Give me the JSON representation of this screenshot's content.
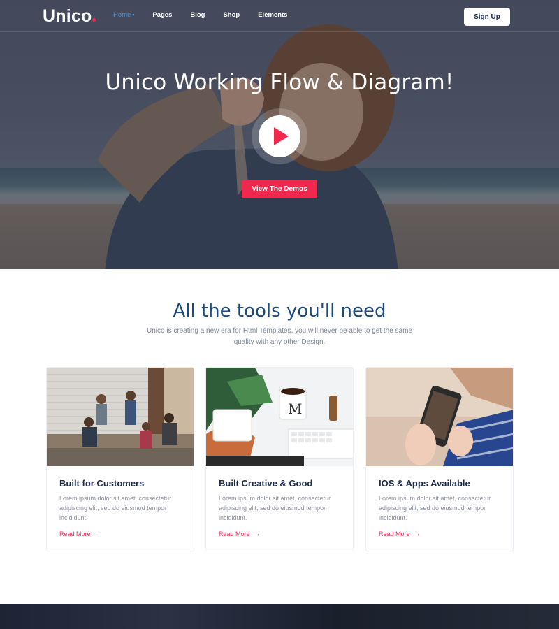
{
  "nav": {
    "logo": "Unico",
    "items": [
      {
        "label": "Home",
        "active": true
      },
      {
        "label": "Pages",
        "active": false
      },
      {
        "label": "Blog",
        "active": false
      },
      {
        "label": "Shop",
        "active": false
      },
      {
        "label": "Elements",
        "active": false
      }
    ],
    "signup_label": "Sign Up"
  },
  "hero": {
    "title": "Unico Working Flow & Diagram!",
    "cta_label": "View The Demos"
  },
  "tools": {
    "title": "All the tools you'll need",
    "subtitle": "Unico is creating a new era for Html Templates, you will never be able to get the same quality with any other Design."
  },
  "cards": [
    {
      "title": "Built for Customers",
      "text": "Lorem ipsum dolor sit amet, consectetur adipiscing elit, sed do eiusmod tempor incididunt.",
      "link": "Read More"
    },
    {
      "title": "Built Creative & Good",
      "text": "Lorem ipsum dolor sit amet, consectetur adipiscing elit, sed do eiusmod tempor incididunt.",
      "link": "Read More"
    },
    {
      "title": "IOS & Apps Available",
      "text": "Lorem ipsum dolor sit amet, consectetur adipiscing elit, sed do eiusmod tempor incididunt.",
      "link": "Read More"
    }
  ],
  "colors": {
    "accent": "#f0284e",
    "active_nav": "#3e9cf5",
    "heading": "#1a4a7e"
  }
}
